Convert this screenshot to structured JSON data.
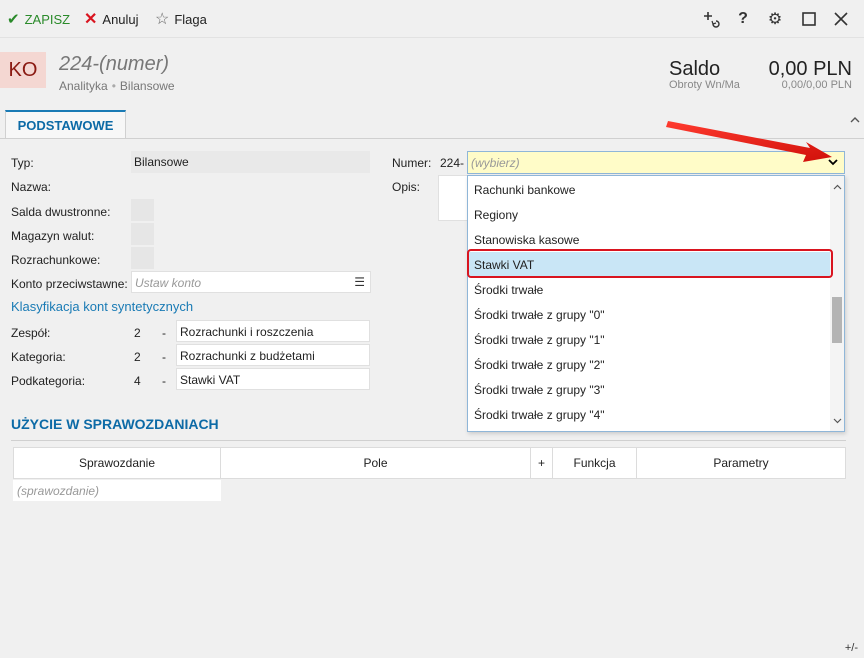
{
  "toolbar": {
    "save_label": "ZAPISZ",
    "cancel_label": "Anuluj",
    "flag_label": "Flaga"
  },
  "header": {
    "badge": "KO",
    "title": "224-(numer)",
    "subtitle_1": "Analityka",
    "subtitle_2": "Bilansowe",
    "saldo_label": "Saldo",
    "saldo_sub": "Obroty Wn/Ma",
    "saldo_value": "0,00 PLN",
    "saldo_value_sub": "0,00/0,00 PLN"
  },
  "tabs": {
    "active": "PODSTAWOWE"
  },
  "form": {
    "typ_label": "Typ:",
    "typ_value": "Bilansowe",
    "nazwa_label": "Nazwa:",
    "saldo_dw_label": "Salda dwustronne:",
    "magazyn_label": "Magazyn walut:",
    "rozrach_label": "Rozrachunkowe:",
    "konto_label": "Konto przeciwstawne:",
    "konto_placeholder": "Ustaw konto",
    "klasyfikacja_link": "Klasyfikacja kont syntetycznych",
    "zespol_label": "Zespół:",
    "zespol_num": "2",
    "zespol_value": "Rozrachunki i roszczenia",
    "kategoria_label": "Kategoria:",
    "kategoria_num": "2",
    "kategoria_value": "Rozrachunki z budżetami",
    "podkategoria_label": "Podkategoria:",
    "podkategoria_num": "4",
    "podkategoria_value": "Stawki VAT",
    "dash": "-",
    "numer_label": "Numer:",
    "numer_prefix": "224-",
    "numer_placeholder": "(wybierz)",
    "opis_label": "Opis:"
  },
  "dropdown": {
    "items": [
      "Rachunki bankowe",
      "Regiony",
      "Stanowiska kasowe",
      "Stawki VAT",
      "Środki trwałe",
      "Środki trwałe z grupy \"0\"",
      "Środki trwałe z grupy \"1\"",
      "Środki trwałe z grupy \"2\"",
      "Środki trwałe z grupy \"3\"",
      "Środki trwałe z grupy \"4\""
    ],
    "selected_index": 3
  },
  "section": {
    "title": "UŻYCIE W SPRAWOZDANIACH"
  },
  "table": {
    "columns": [
      "Sprawozdanie",
      "Pole",
      "+",
      "Funkcja",
      "Parametry"
    ],
    "row_placeholder": "(sprawozdanie)"
  },
  "footer": {
    "corner": "+/-"
  },
  "colors": {
    "accent": "#1a7bb5",
    "save_green": "#2a8a2a",
    "cancel_red": "#d9141f",
    "highlight_red": "#d9141f",
    "input_yellow": "#fffcc8",
    "selected_blue": "#c9e6f6"
  },
  "icons": {
    "save": "check-icon",
    "cancel": "x-icon",
    "flag": "star-icon",
    "add_link": "add-link-icon",
    "help": "question-icon",
    "settings": "gear-icon",
    "maximize": "square-icon",
    "close": "close-icon"
  }
}
